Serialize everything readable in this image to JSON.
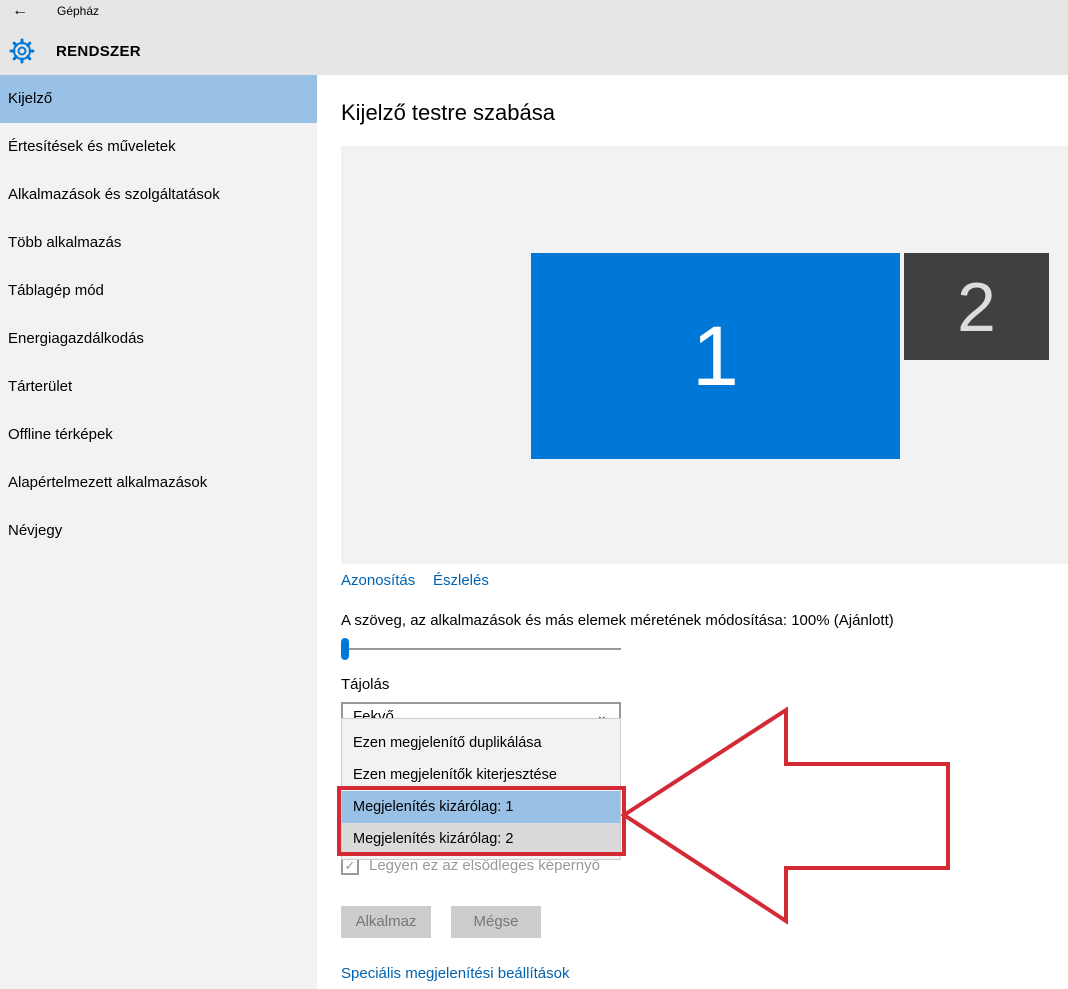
{
  "header": {
    "back_icon": "back-arrow-icon",
    "app_title": "Gépház",
    "section_icon": "gear-icon",
    "section_title": "RENDSZER"
  },
  "sidebar": {
    "items": [
      {
        "label": "Kijelző",
        "selected": true
      },
      {
        "label": "Értesítések és műveletek"
      },
      {
        "label": "Alkalmazások és szolgáltatások"
      },
      {
        "label": "Több alkalmazás"
      },
      {
        "label": "Táblagép mód"
      },
      {
        "label": "Energiagazdálkodás"
      },
      {
        "label": "Tárterület"
      },
      {
        "label": "Offline térképek"
      },
      {
        "label": "Alapértelmezett alkalmazások"
      },
      {
        "label": "Névjegy"
      }
    ]
  },
  "main": {
    "title": "Kijelző testre szabása",
    "monitors": [
      {
        "number": "1"
      },
      {
        "number": "2"
      }
    ],
    "identify_link": "Azonosítás",
    "detect_link": "Észlelés",
    "scale_label": "A szöveg, az alkalmazások és más elemek méretének módosítása: 100% (Ajánlott)",
    "scale_slider_position": 0,
    "orientation_label": "Tájolás",
    "orientation_value": "Fekvő",
    "multi_display_options": [
      "Ezen megjelenítő duplikálása",
      "Ezen megjelenítők kiterjesztése",
      "Megjelenítés kizárólag: 1",
      "Megjelenítés kizárólag: 2"
    ],
    "selected_option_index": 2,
    "primary_checkbox_label": "Legyen ez az elsődleges képernyő",
    "primary_checkbox_checked": true,
    "apply_button": "Alkalmaz",
    "cancel_button": "Mégse",
    "advanced_link": "Speciális megjelenítési beállítások"
  },
  "colors": {
    "accent": "#0078d7",
    "sidebar_selected": "#99c1e6",
    "highlight_annotation": "#d42a35"
  }
}
